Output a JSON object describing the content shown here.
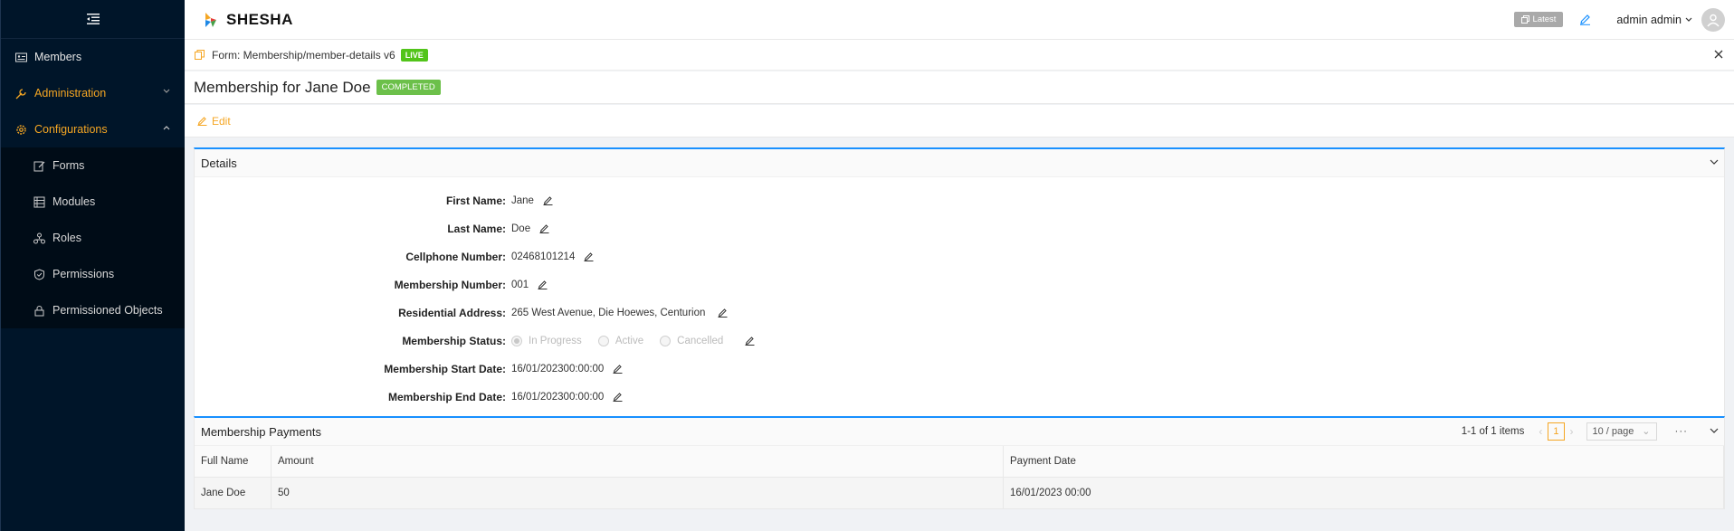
{
  "sidebar": {
    "items": [
      {
        "label": "Members",
        "icon": "id-card-icon"
      },
      {
        "label": "Administration",
        "icon": "wrench-icon"
      },
      {
        "label": "Configurations",
        "icon": "gear-icon"
      }
    ],
    "submenu": [
      {
        "label": "Forms",
        "icon": "form-edit-icon"
      },
      {
        "label": "Modules",
        "icon": "modules-icon"
      },
      {
        "label": "Roles",
        "icon": "roles-icon"
      },
      {
        "label": "Permissions",
        "icon": "shield-check-icon"
      },
      {
        "label": "Permissioned Objects",
        "icon": "lock-icon"
      }
    ]
  },
  "header": {
    "logo_text": "SHESHA",
    "latest_label": "Latest",
    "user_name": "admin admin"
  },
  "form_bar": {
    "label": "Form: Membership/member-details v6",
    "status_tag": "LIVE"
  },
  "page": {
    "title": "Membership for Jane Doe",
    "status_tag": "COMPLETED",
    "edit_label": "Edit"
  },
  "details": {
    "title": "Details",
    "fields": {
      "first_name": {
        "label": "First Name:",
        "value": "Jane"
      },
      "last_name": {
        "label": "Last Name:",
        "value": "Doe"
      },
      "cellphone": {
        "label": "Cellphone Number:",
        "value": "02468101214"
      },
      "membership_number": {
        "label": "Membership Number:",
        "value": "001"
      },
      "address": {
        "label": "Residential Address:",
        "value": "265 West Avenue, Die Hoewes, Centurion"
      },
      "status": {
        "label": "Membership Status:",
        "options": [
          "In Progress",
          "Active",
          "Cancelled"
        ],
        "selected": "In Progress"
      },
      "start_date": {
        "label": "Membership Start Date:",
        "value": "16/01/202300:00:00"
      },
      "end_date": {
        "label": "Membership End Date:",
        "value": "16/01/202300:00:00"
      }
    }
  },
  "payments": {
    "title": "Membership Payments",
    "pager": {
      "count": "1-1 of 1 items",
      "page": "1",
      "page_size": "10 / page",
      "more": "···"
    },
    "columns": [
      "Full Name",
      "Amount",
      "Payment Date"
    ],
    "rows": [
      [
        "Jane Doe",
        "50",
        "16/01/2023 00:00"
      ]
    ]
  },
  "colors": {
    "accent": "#f5a623",
    "sidebar_bg": "#001529",
    "panel_border": "#1890ff",
    "live": "#52c41a"
  }
}
